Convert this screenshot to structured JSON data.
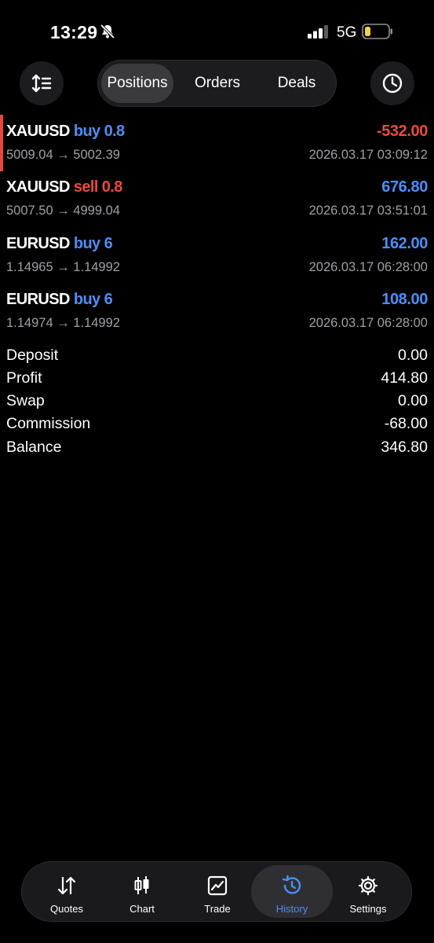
{
  "status_bar": {
    "time": "13:29",
    "network": "5G",
    "icons": [
      "bell-slash-icon",
      "signal-icon",
      "battery-icon"
    ]
  },
  "toolbar": {
    "sort_icon": "sort-arrows-icon",
    "history_icon": "clock-icon",
    "tabs": [
      {
        "label": "Positions",
        "active": true
      },
      {
        "label": "Orders",
        "active": false
      },
      {
        "label": "Deals",
        "active": false
      }
    ]
  },
  "positions": [
    {
      "symbol": "XAUUSD",
      "side": "buy",
      "volume": "0.8",
      "prices": "5009.04 → 5002.39",
      "profit": "-532.00",
      "time": "2026.03.17 03:09:12"
    },
    {
      "symbol": "XAUUSD",
      "side": "sell",
      "volume": "0.8",
      "prices": "5007.50 → 4999.04",
      "profit": "676.80",
      "time": "2026.03.17 03:51:01"
    },
    {
      "symbol": "EURUSD",
      "side": "buy",
      "volume": "6",
      "prices": "1.14965 → 1.14992",
      "profit": "162.00",
      "time": "2026.03.17 06:28:00"
    },
    {
      "symbol": "EURUSD",
      "side": "buy",
      "volume": "6",
      "prices": "1.14974 → 1.14992",
      "profit": "108.00",
      "time": "2026.03.17 06:28:00"
    }
  ],
  "summary": [
    {
      "label": "Deposit",
      "value": "0.00"
    },
    {
      "label": "Profit",
      "value": "414.80"
    },
    {
      "label": "Swap",
      "value": "0.00"
    },
    {
      "label": "Commission",
      "value": "-68.00"
    },
    {
      "label": "Balance",
      "value": "346.80"
    }
  ],
  "nav": [
    {
      "label": "Quotes",
      "icon": "quotes-arrows-icon",
      "active": false
    },
    {
      "label": "Chart",
      "icon": "candlestick-icon",
      "active": false
    },
    {
      "label": "Trade",
      "icon": "trade-chart-icon",
      "active": false
    },
    {
      "label": "History",
      "icon": "history-icon",
      "active": true
    },
    {
      "label": "Settings",
      "icon": "gear-icon",
      "active": false
    }
  ],
  "colors": {
    "background": "#000000",
    "accent_blue": "#4c8ef7",
    "loss_red": "#ea4a3d",
    "muted_text": "#a0a0a5"
  }
}
